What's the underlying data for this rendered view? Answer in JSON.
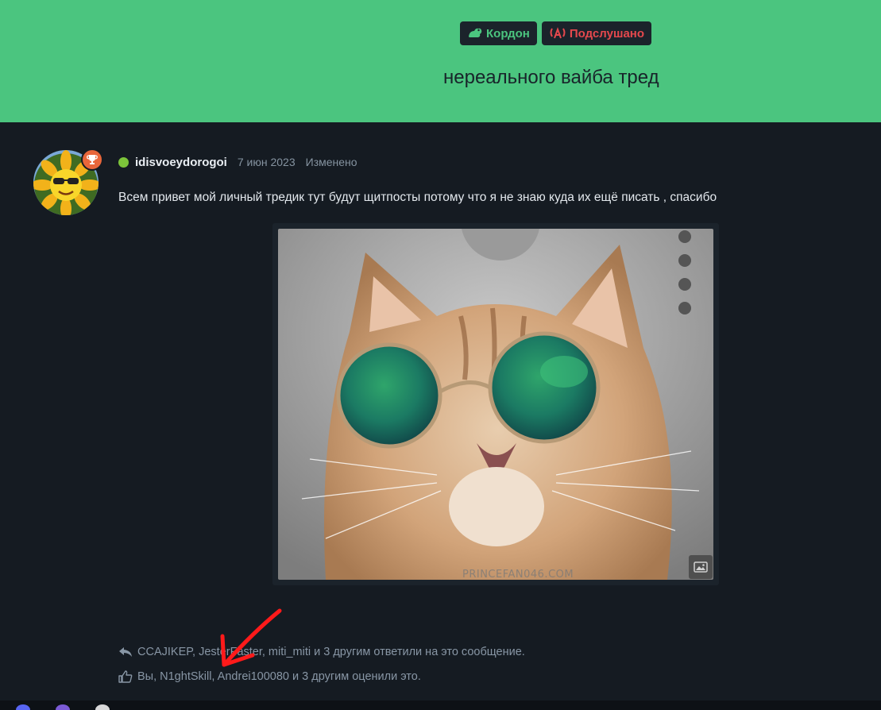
{
  "header": {
    "badges": [
      {
        "label": "Кордон",
        "color": "#4bc57f",
        "icon": "frog-icon"
      },
      {
        "label": "Подслушано",
        "color": "#e5484d",
        "icon": "broadcast-icon"
      }
    ],
    "thread_title": "нереального вайба тред",
    "background": "#4bc57f"
  },
  "post": {
    "author": "idisvoeydorogoi",
    "online": true,
    "date": "7 июн 2023",
    "edited_label": "Изменено",
    "message": "Всем привет мой личный тредик тут будут щитпосты потому что я не знаю куда их ещё писать , спасибо",
    "award_icon": "trophy-icon",
    "media": {
      "description_icon": "cat-with-sunglasses-image",
      "watermark": "PRINCEFAN046.COM",
      "button_icon": "image-icon"
    }
  },
  "reactions": {
    "replies": "CCAJIKEP, JesterFaster, miti_miti и 3 другим ответили на это сообщение.",
    "likes": "Вы, N1ghtSkill, Andrei100080 и 3 другим оценили это."
  },
  "colors": {
    "background": "#151b22",
    "accent": "#4bc57f",
    "muted_text": "#8896a5",
    "annotation_arrow": "#ff1a1a"
  }
}
